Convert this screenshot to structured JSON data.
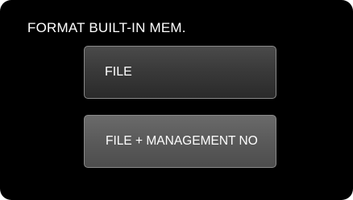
{
  "screen": {
    "title": "FORMAT BUILT-IN MEM."
  },
  "menu": {
    "items": [
      {
        "label": "FILE"
      },
      {
        "label": "FILE + MANAGEMENT NO"
      }
    ]
  },
  "colors": {
    "background": "#000000",
    "text": "#ffffff",
    "button_border": "#8a8a8a",
    "button_dark": "#3a3a3a",
    "button_light": "#5a5a5a"
  }
}
